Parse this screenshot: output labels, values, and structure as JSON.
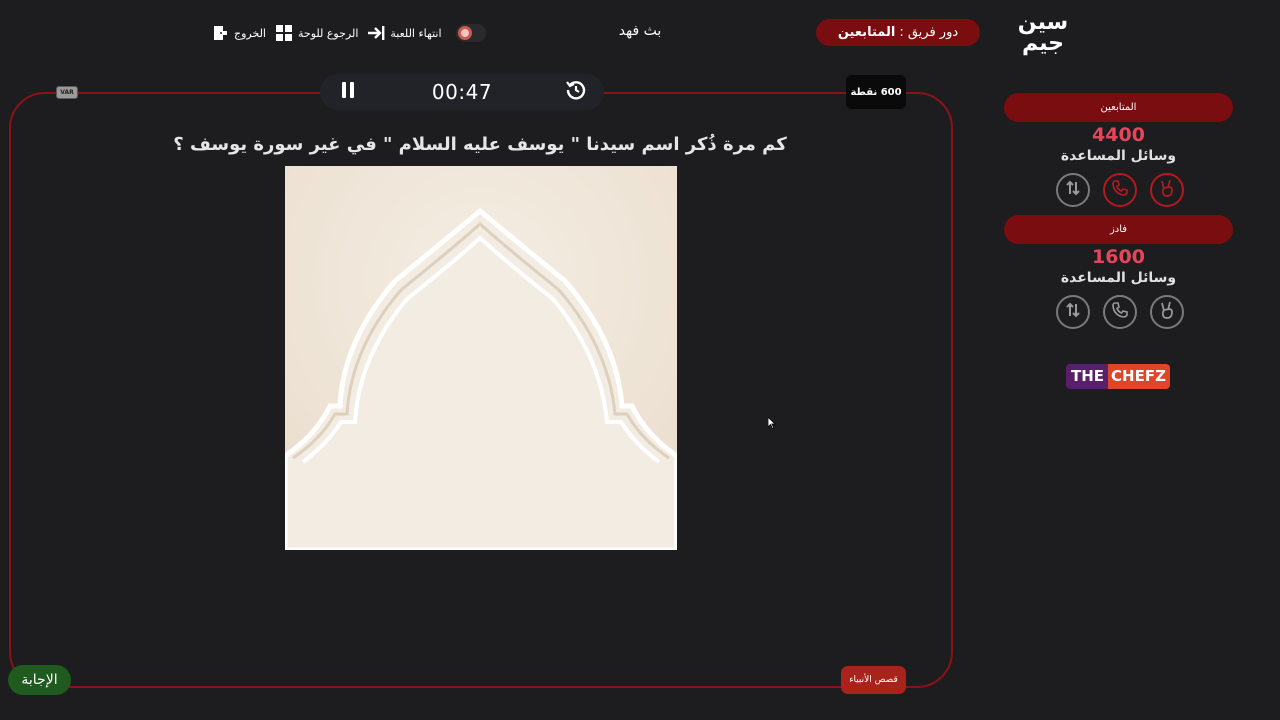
{
  "logo": {
    "line1": "سين",
    "line2": "جيم"
  },
  "turn": {
    "label": "دور فريق :",
    "team": "المتابعين"
  },
  "streamer": "بث فهد",
  "nav": {
    "exit": "الخروج",
    "back_to_board": "الرجوع للوحة",
    "end_game": "انتهاء اللعبة"
  },
  "var_label": "VAR",
  "timer": {
    "time": "00:47"
  },
  "points": "600 نقطة",
  "question": "كم مرة ذُكر اسم سيدنا \" يوسف عليه السلام \" في غير سورة يوسف ؟",
  "category": "قصص الأنبياء",
  "answer_button": "الإجابة",
  "teams": [
    {
      "name": "المتابعين",
      "score": "4400",
      "aids_label": "وسائل المساعدة"
    },
    {
      "name": "فادز",
      "score": "1600",
      "aids_label": "وسائل المساعدة"
    }
  ],
  "sponsor": {
    "part1": "THE",
    "part2": "CHEFZ"
  },
  "colors": {
    "background": "#1d1d1f",
    "accent_red": "#7a0d10",
    "frame_red": "#8a1218",
    "score_red": "#e8455a",
    "answer_green": "#1f5a1e",
    "category_red": "#a8241a"
  },
  "icons": {
    "exit": "door-exit-icon",
    "back": "grid-icon",
    "end": "arrow-to-line-icon",
    "pause": "pause-icon",
    "reset": "history-icon",
    "aid_1": "swap-icon",
    "aid_2": "phone-icon",
    "aid_3": "victory-hand-icon"
  }
}
